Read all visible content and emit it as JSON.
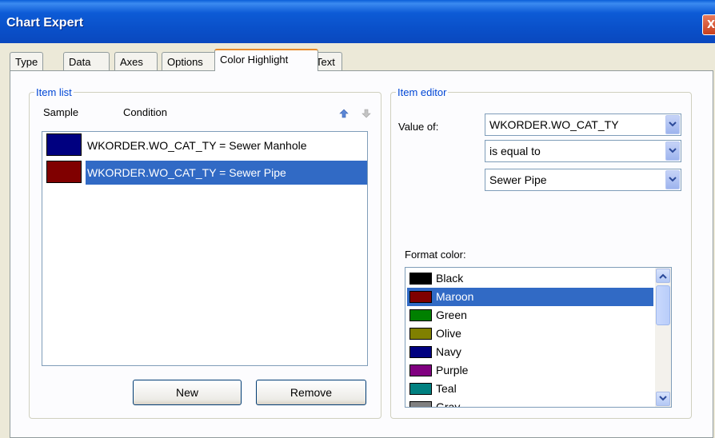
{
  "window": {
    "title": "Chart Expert",
    "close_glyph": "X"
  },
  "tabs": [
    {
      "label": "Type"
    },
    {
      "label": "Data"
    },
    {
      "label": "Axes"
    },
    {
      "label": "Options"
    },
    {
      "label": "Color Highlight",
      "active": true
    },
    {
      "label": "Text"
    }
  ],
  "item_list": {
    "legend": "Item list",
    "sample_header": "Sample",
    "condition_header": "Condition",
    "items": [
      {
        "condition": "WKORDER.WO_CAT_TY = Sewer Manhole",
        "color": "#000080",
        "selected": false
      },
      {
        "condition": "WKORDER.WO_CAT_TY = Sewer Pipe",
        "color": "#800000",
        "selected": true
      }
    ],
    "new_label": "New",
    "remove_label": "Remove"
  },
  "item_editor": {
    "legend": "Item editor",
    "value_of_label": "Value of:",
    "field_value": "WKORDER.WO_CAT_TY",
    "operator_value": "is equal to",
    "compare_value": "Sewer Pipe",
    "format_color_label": "Format color:",
    "colors": [
      {
        "name": "Black",
        "hex": "#000000"
      },
      {
        "name": "Maroon",
        "hex": "#800000",
        "selected": true
      },
      {
        "name": "Green",
        "hex": "#008000"
      },
      {
        "name": "Olive",
        "hex": "#808000"
      },
      {
        "name": "Navy",
        "hex": "#000080"
      },
      {
        "name": "Purple",
        "hex": "#800080"
      },
      {
        "name": "Teal",
        "hex": "#008080"
      },
      {
        "name": "Gray",
        "hex": "#808080"
      }
    ]
  },
  "icons": {
    "move_up": "arrow-up-icon",
    "move_down": "arrow-down-icon",
    "dropdown": "chevron-down-icon"
  },
  "colors": {
    "selection": "#316ac5",
    "title_bar": "#0a5fd8",
    "group_legend": "#0046d5"
  }
}
